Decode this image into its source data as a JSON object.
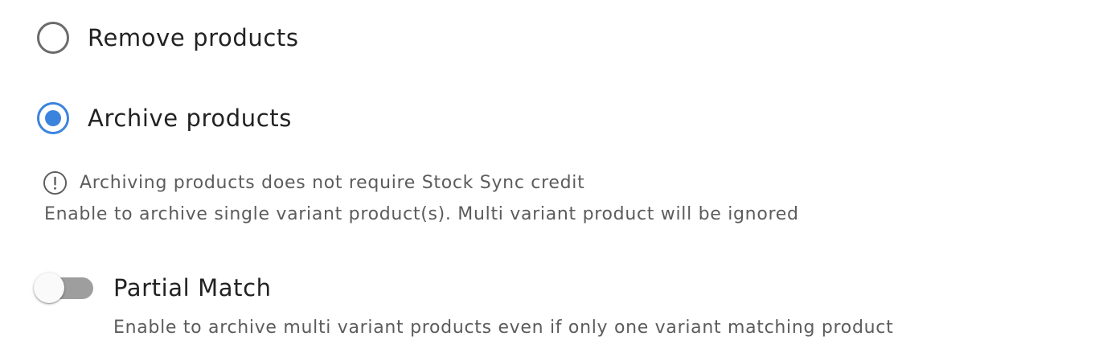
{
  "radio_group": {
    "options": [
      {
        "label": "Remove products",
        "selected": false
      },
      {
        "label": "Archive products",
        "selected": true
      }
    ]
  },
  "info": {
    "icon": "exclamation-circle-icon",
    "note": "Archiving products does not require Stock Sync credit",
    "helper": "Enable to archive single variant product(s). Multi variant product will be ignored"
  },
  "partial_match": {
    "label": "Partial Match",
    "enabled": false,
    "helper": "Enable to archive multi variant products even if only one variant matching product"
  },
  "colors": {
    "accent": "#3b84de",
    "radio_unchecked": "#6b6b6b",
    "switch_track_off": "#9e9e9e",
    "secondary_text": "#5c5c5c"
  }
}
